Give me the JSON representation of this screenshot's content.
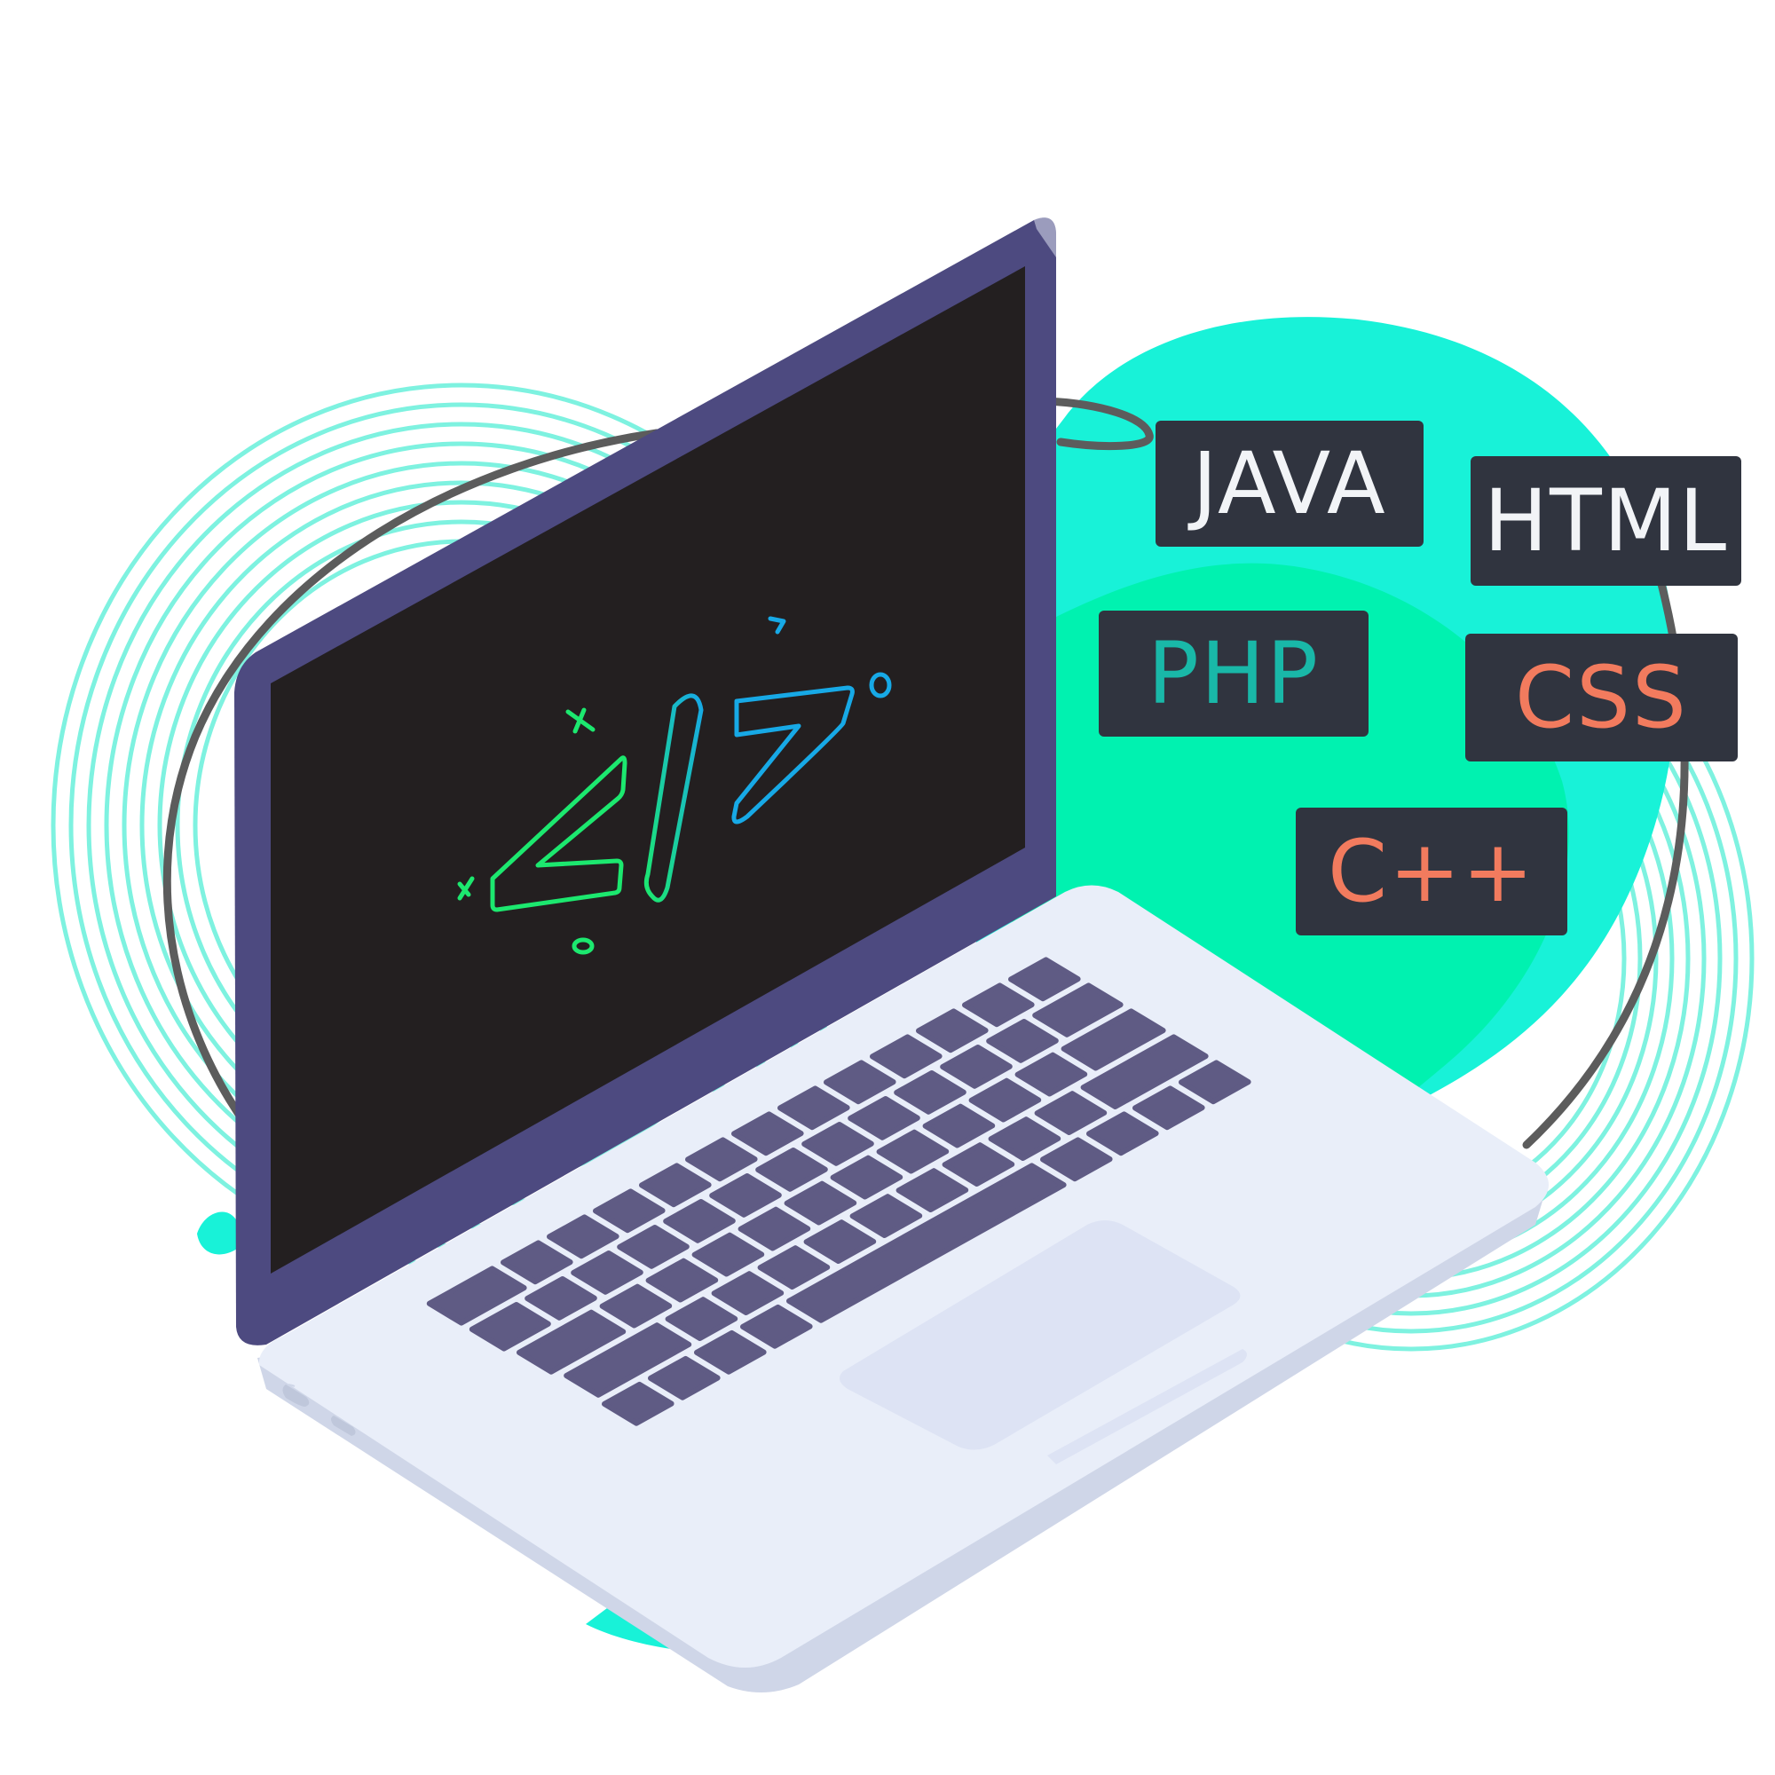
{
  "colors": {
    "blob_teal": "#18f2d8",
    "blob_green": "#00f2b0",
    "ring_lines": "#7ef2e0",
    "outline_loop": "#5c5c5c",
    "laptop_bezel": "#4d4a80",
    "screen": "#231f20",
    "laptop_base": "#e9eef9",
    "keys": "#5f5b84",
    "touchpad": "#dde3f4",
    "tag_bg": "#30343f",
    "code_green": "#1ce86f",
    "code_blue": "#17a9e6"
  },
  "screen": {
    "code_symbol": "</>",
    "icon": "code-brackets-icon"
  },
  "tags": [
    {
      "id": "java",
      "label": "JAVA",
      "color": "#f2f4f7"
    },
    {
      "id": "html",
      "label": "HTML",
      "color": "#f2f4f7"
    },
    {
      "id": "php",
      "label": "PHP",
      "color": "#19b8a8"
    },
    {
      "id": "css",
      "label": "CSS",
      "color": "#f27b5e"
    },
    {
      "id": "cpp",
      "label": "C++",
      "color": "#f27b5e"
    }
  ]
}
